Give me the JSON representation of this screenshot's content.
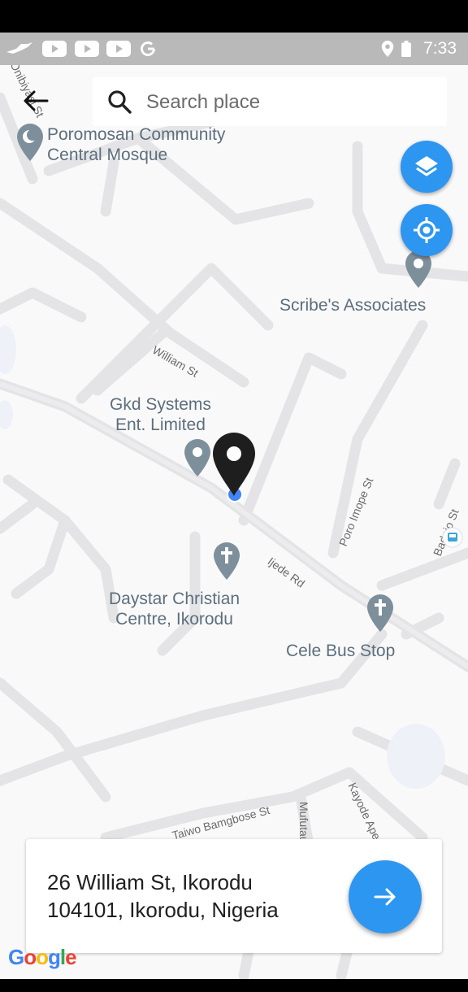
{
  "status_bar": {
    "time": "7:33",
    "icons": [
      "bird-icon",
      "youtube-icon",
      "youtube-icon",
      "youtube-icon",
      "google-icon",
      "location-icon",
      "battery-icon"
    ]
  },
  "search": {
    "placeholder": "Search place"
  },
  "map": {
    "places": [
      {
        "id": "mosque",
        "name_line1": "Poromosan Community",
        "name_line2": "Central Mosque",
        "icon": "mosque-pin-icon"
      },
      {
        "id": "scribe",
        "name_line1": "Scribe's Associates",
        "icon": "place-pin-icon"
      },
      {
        "id": "gkd",
        "name_line1": "Gkd Systems",
        "name_line2": "Ent. Limited",
        "icon": "place-pin-icon"
      },
      {
        "id": "daystar",
        "name_line1": "Daystar Christian",
        "name_line2": "Centre, Ikorodu",
        "icon": "church-pin-icon"
      },
      {
        "id": "cele",
        "name_line1": "Cele Bus Stop",
        "icon": "church-pin-icon"
      }
    ],
    "roads": [
      "Olu Onibiyasi St",
      "William St",
      "Ijede Rd",
      "Poro Imope St",
      "Badejo St",
      "Taiwo Bamgbose St",
      "Mufutau",
      "Kayode Ape"
    ],
    "marker": "selected-location-marker"
  },
  "card": {
    "address_line1": "26 William St, Ikorodu",
    "address_line2": "104101, Ikorodu, Nigeria"
  },
  "attribution": "Google",
  "colors": {
    "accent": "#2d96f0",
    "label": "#5c6f7c",
    "map_bg": "#faf9fa"
  }
}
